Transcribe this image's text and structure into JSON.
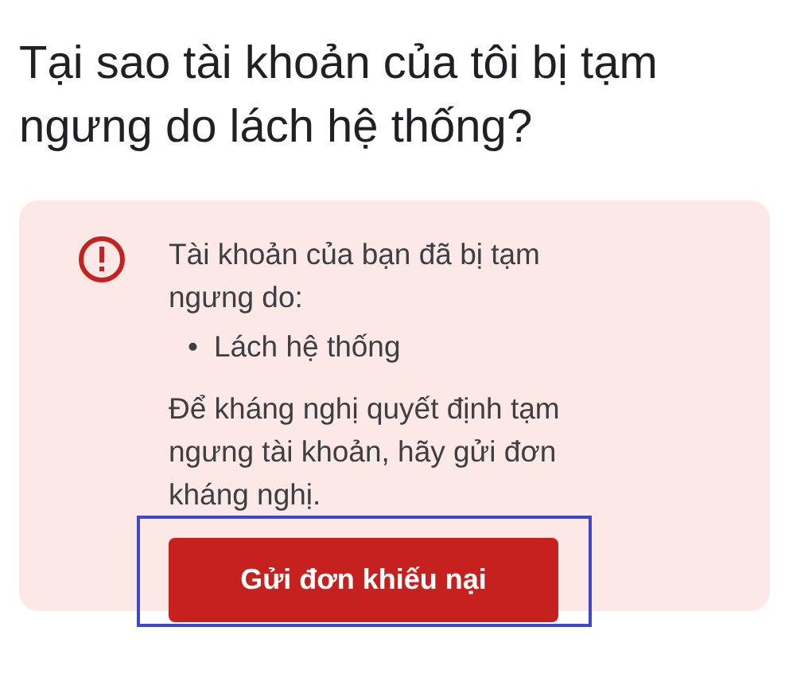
{
  "heading": "Tại sao tài khoản của tôi bị tạm ngưng do lách hệ thống?",
  "notice": {
    "intro": "Tài khoản của bạn đã bị tạm ngưng do:",
    "reasons": [
      {
        "bullet": "•",
        "text": "Lách hệ thống"
      }
    ],
    "appeal_text": "Để kháng nghị quyết định tạm ngưng tài khoản, hãy gửi đơn kháng nghị.",
    "button": "Gửi đơn khiếu nại"
  }
}
